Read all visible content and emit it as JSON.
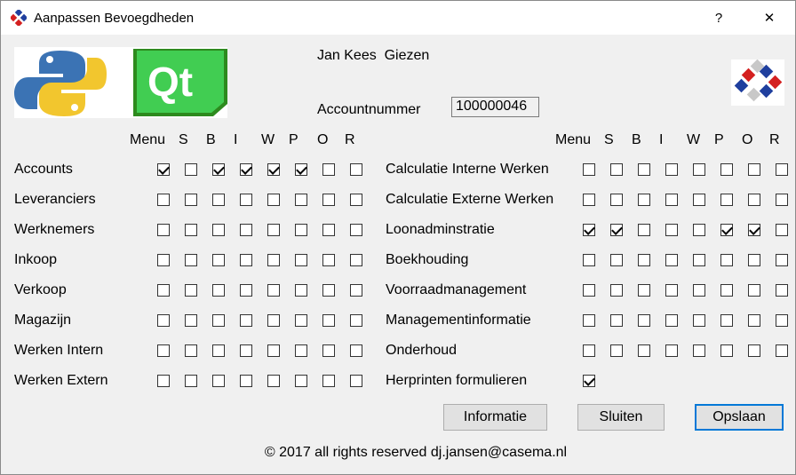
{
  "window": {
    "title": "Aanpassen Bevoegdheden",
    "help_label": "?",
    "close_label": "✕"
  },
  "user": {
    "name": "Jan Kees  Giezen",
    "account_label": "Accountnummer",
    "account_number": "100000046"
  },
  "columns": [
    "Menu",
    "S",
    "B",
    "I",
    "W",
    "P",
    "O",
    "R"
  ],
  "left_rows": [
    {
      "label": "Accounts",
      "checks": [
        true,
        false,
        true,
        true,
        true,
        true,
        false,
        false
      ]
    },
    {
      "label": "Leveranciers",
      "checks": [
        false,
        false,
        false,
        false,
        false,
        false,
        false,
        false
      ]
    },
    {
      "label": "Werknemers",
      "checks": [
        false,
        false,
        false,
        false,
        false,
        false,
        false,
        false
      ]
    },
    {
      "label": "Inkoop",
      "checks": [
        false,
        false,
        false,
        false,
        false,
        false,
        false,
        false
      ]
    },
    {
      "label": "Verkoop",
      "checks": [
        false,
        false,
        false,
        false,
        false,
        false,
        false,
        false
      ]
    },
    {
      "label": "Magazijn",
      "checks": [
        false,
        false,
        false,
        false,
        false,
        false,
        false,
        false
      ]
    },
    {
      "label": "Werken Intern",
      "checks": [
        false,
        false,
        false,
        false,
        false,
        false,
        false,
        false
      ]
    },
    {
      "label": "Werken Extern",
      "checks": [
        false,
        false,
        false,
        false,
        false,
        false,
        false,
        false
      ]
    }
  ],
  "right_rows": [
    {
      "label": "Calculatie Interne Werken",
      "checks": [
        false,
        false,
        false,
        false,
        false,
        false,
        false,
        false
      ]
    },
    {
      "label": "Calculatie Externe Werken",
      "checks": [
        false,
        false,
        false,
        false,
        false,
        false,
        false,
        false
      ]
    },
    {
      "label": "Loonadminstratie",
      "checks": [
        true,
        true,
        false,
        false,
        false,
        true,
        true,
        false
      ]
    },
    {
      "label": "Boekhouding",
      "checks": [
        false,
        false,
        false,
        false,
        false,
        false,
        false,
        false
      ]
    },
    {
      "label": "Voorraadmanagement",
      "checks": [
        false,
        false,
        false,
        false,
        false,
        false,
        false,
        false
      ]
    },
    {
      "label": "Managementinformatie",
      "checks": [
        false,
        false,
        false,
        false,
        false,
        false,
        false,
        false
      ]
    },
    {
      "label": "Onderhoud",
      "checks": [
        false,
        false,
        false,
        false,
        false,
        false,
        false,
        false
      ]
    },
    {
      "label": "Herprinten formulieren",
      "checks": [
        true
      ]
    }
  ],
  "buttons": {
    "info": "Informatie",
    "close": "Sluiten",
    "save": "Opslaan"
  },
  "footer": "© 2017 all rights reserved dj.jansen@casema.nl",
  "logos": {
    "left_1": "python-logo",
    "left_2": "qt-logo",
    "qt_text": "Qt",
    "right": "company-logo"
  }
}
